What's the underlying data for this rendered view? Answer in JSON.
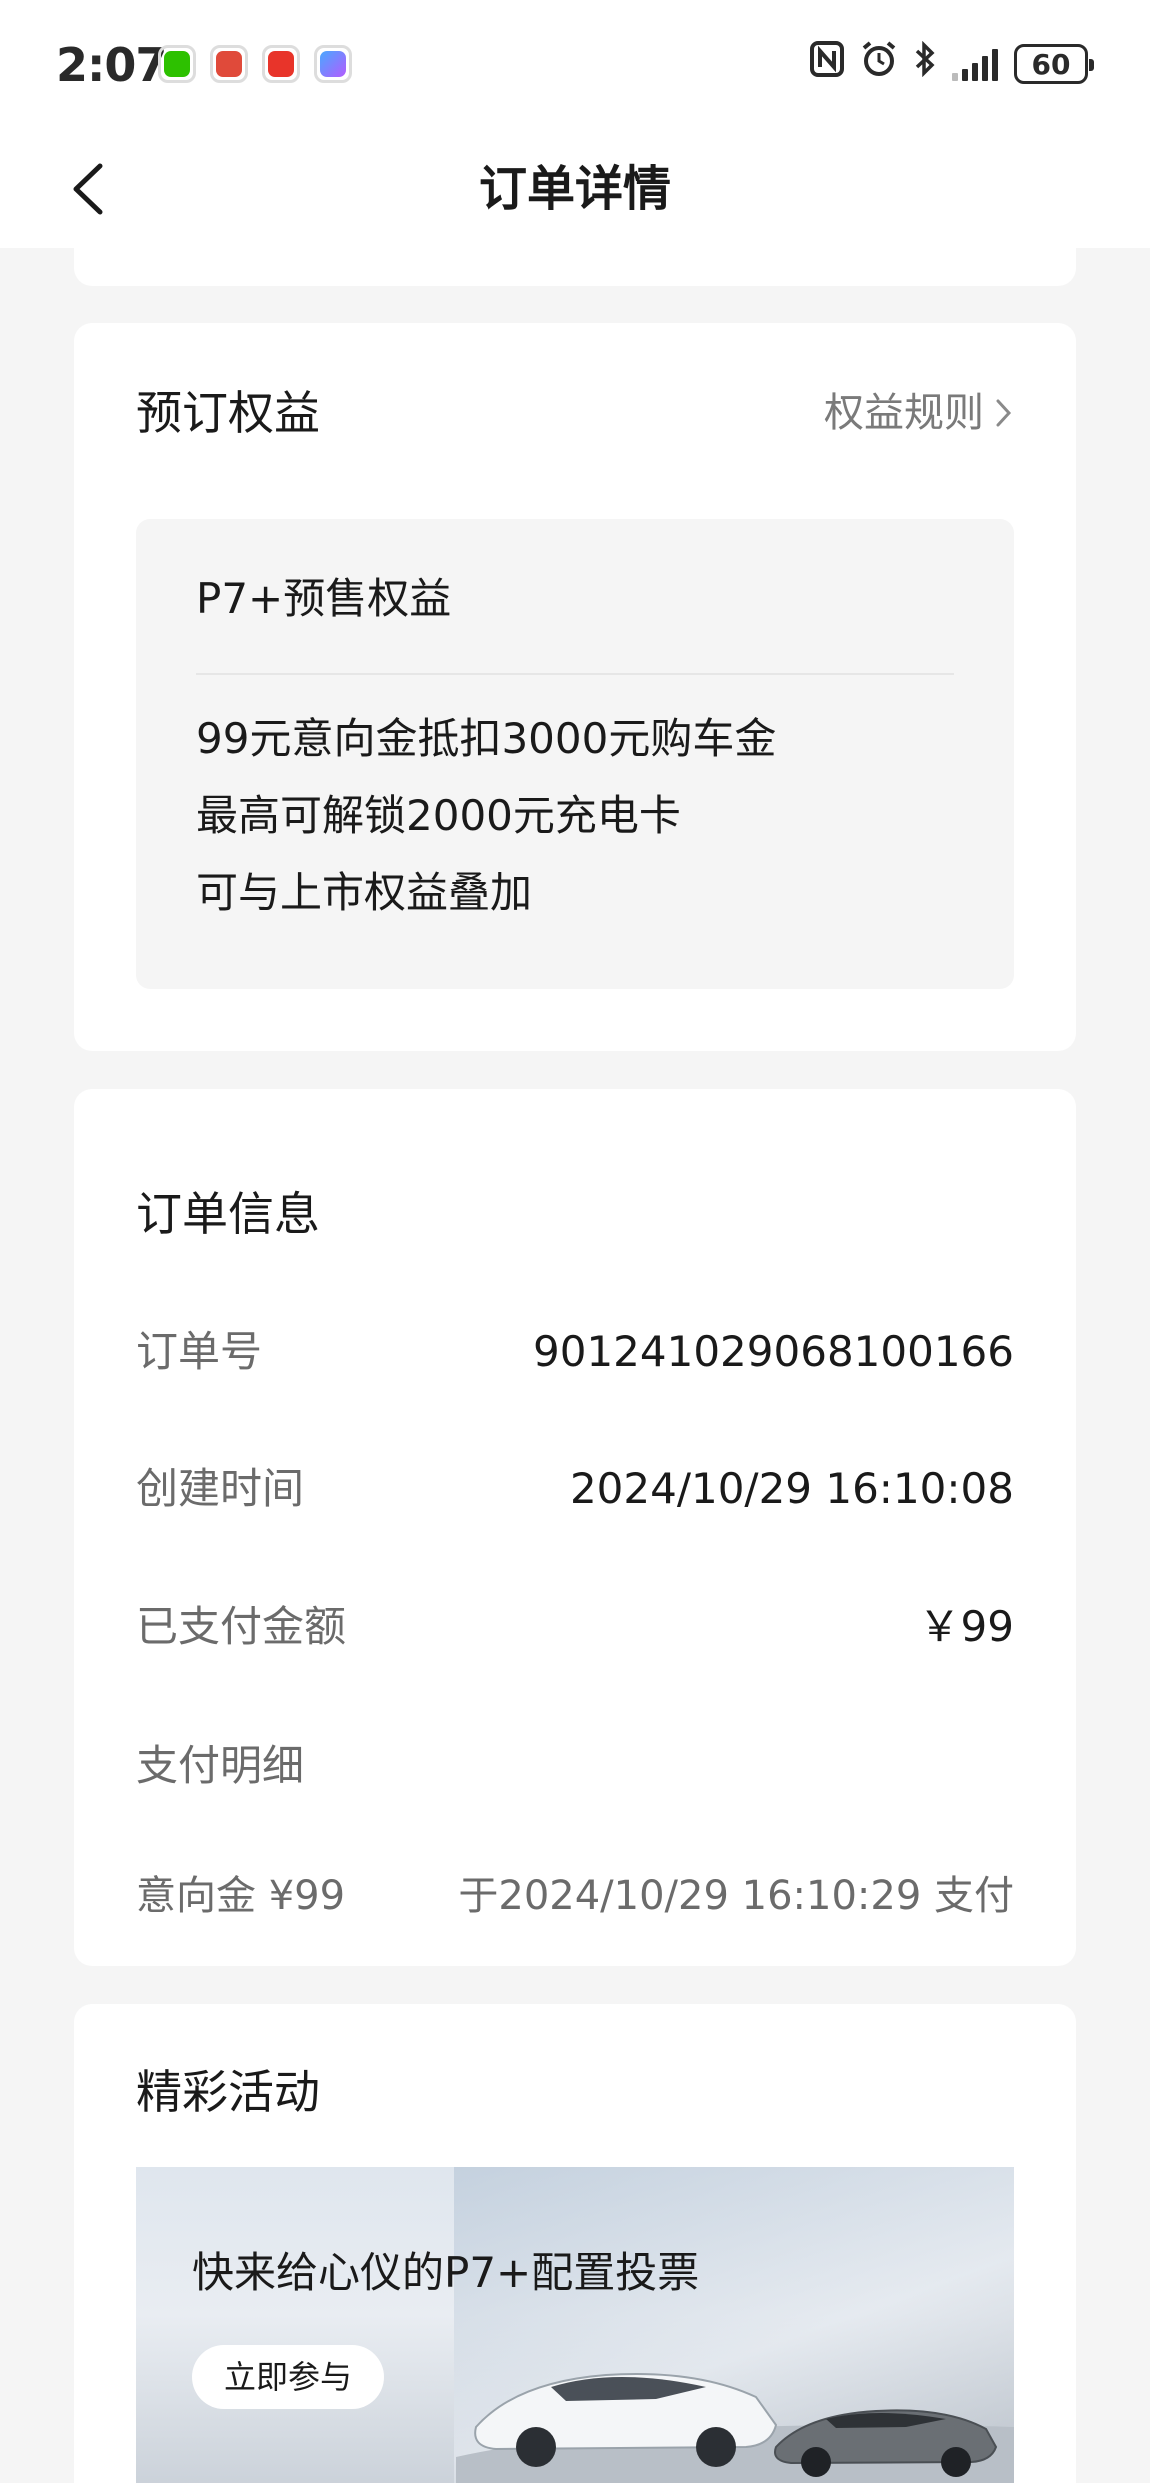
{
  "status_bar": {
    "time": "2:07",
    "battery": "60"
  },
  "header": {
    "title": "订单详情"
  },
  "benefits": {
    "title": "预订权益",
    "rule_link": "权益规则",
    "box_title": "P7+预售权益",
    "lines": [
      "99元意向金抵扣3000元购车金",
      "最高可解锁2000元充电卡",
      "可与上市权益叠加"
    ]
  },
  "order_info": {
    "title": "订单信息",
    "order_no_label": "订单号",
    "order_no": "901241029068100166",
    "created_label": "创建时间",
    "created": "2024/10/29 16:10:08",
    "paid_label": "已支付金额",
    "paid": "￥99",
    "pay_detail_label": "支付明细",
    "pay_detail_item": "意向金 ¥99",
    "pay_detail_time": "于2024/10/29 16:10:29 支付"
  },
  "activities": {
    "title": "精彩活动",
    "banner_title": "快来给心仪的P7+配置投票",
    "banner_button": "立即参与"
  }
}
